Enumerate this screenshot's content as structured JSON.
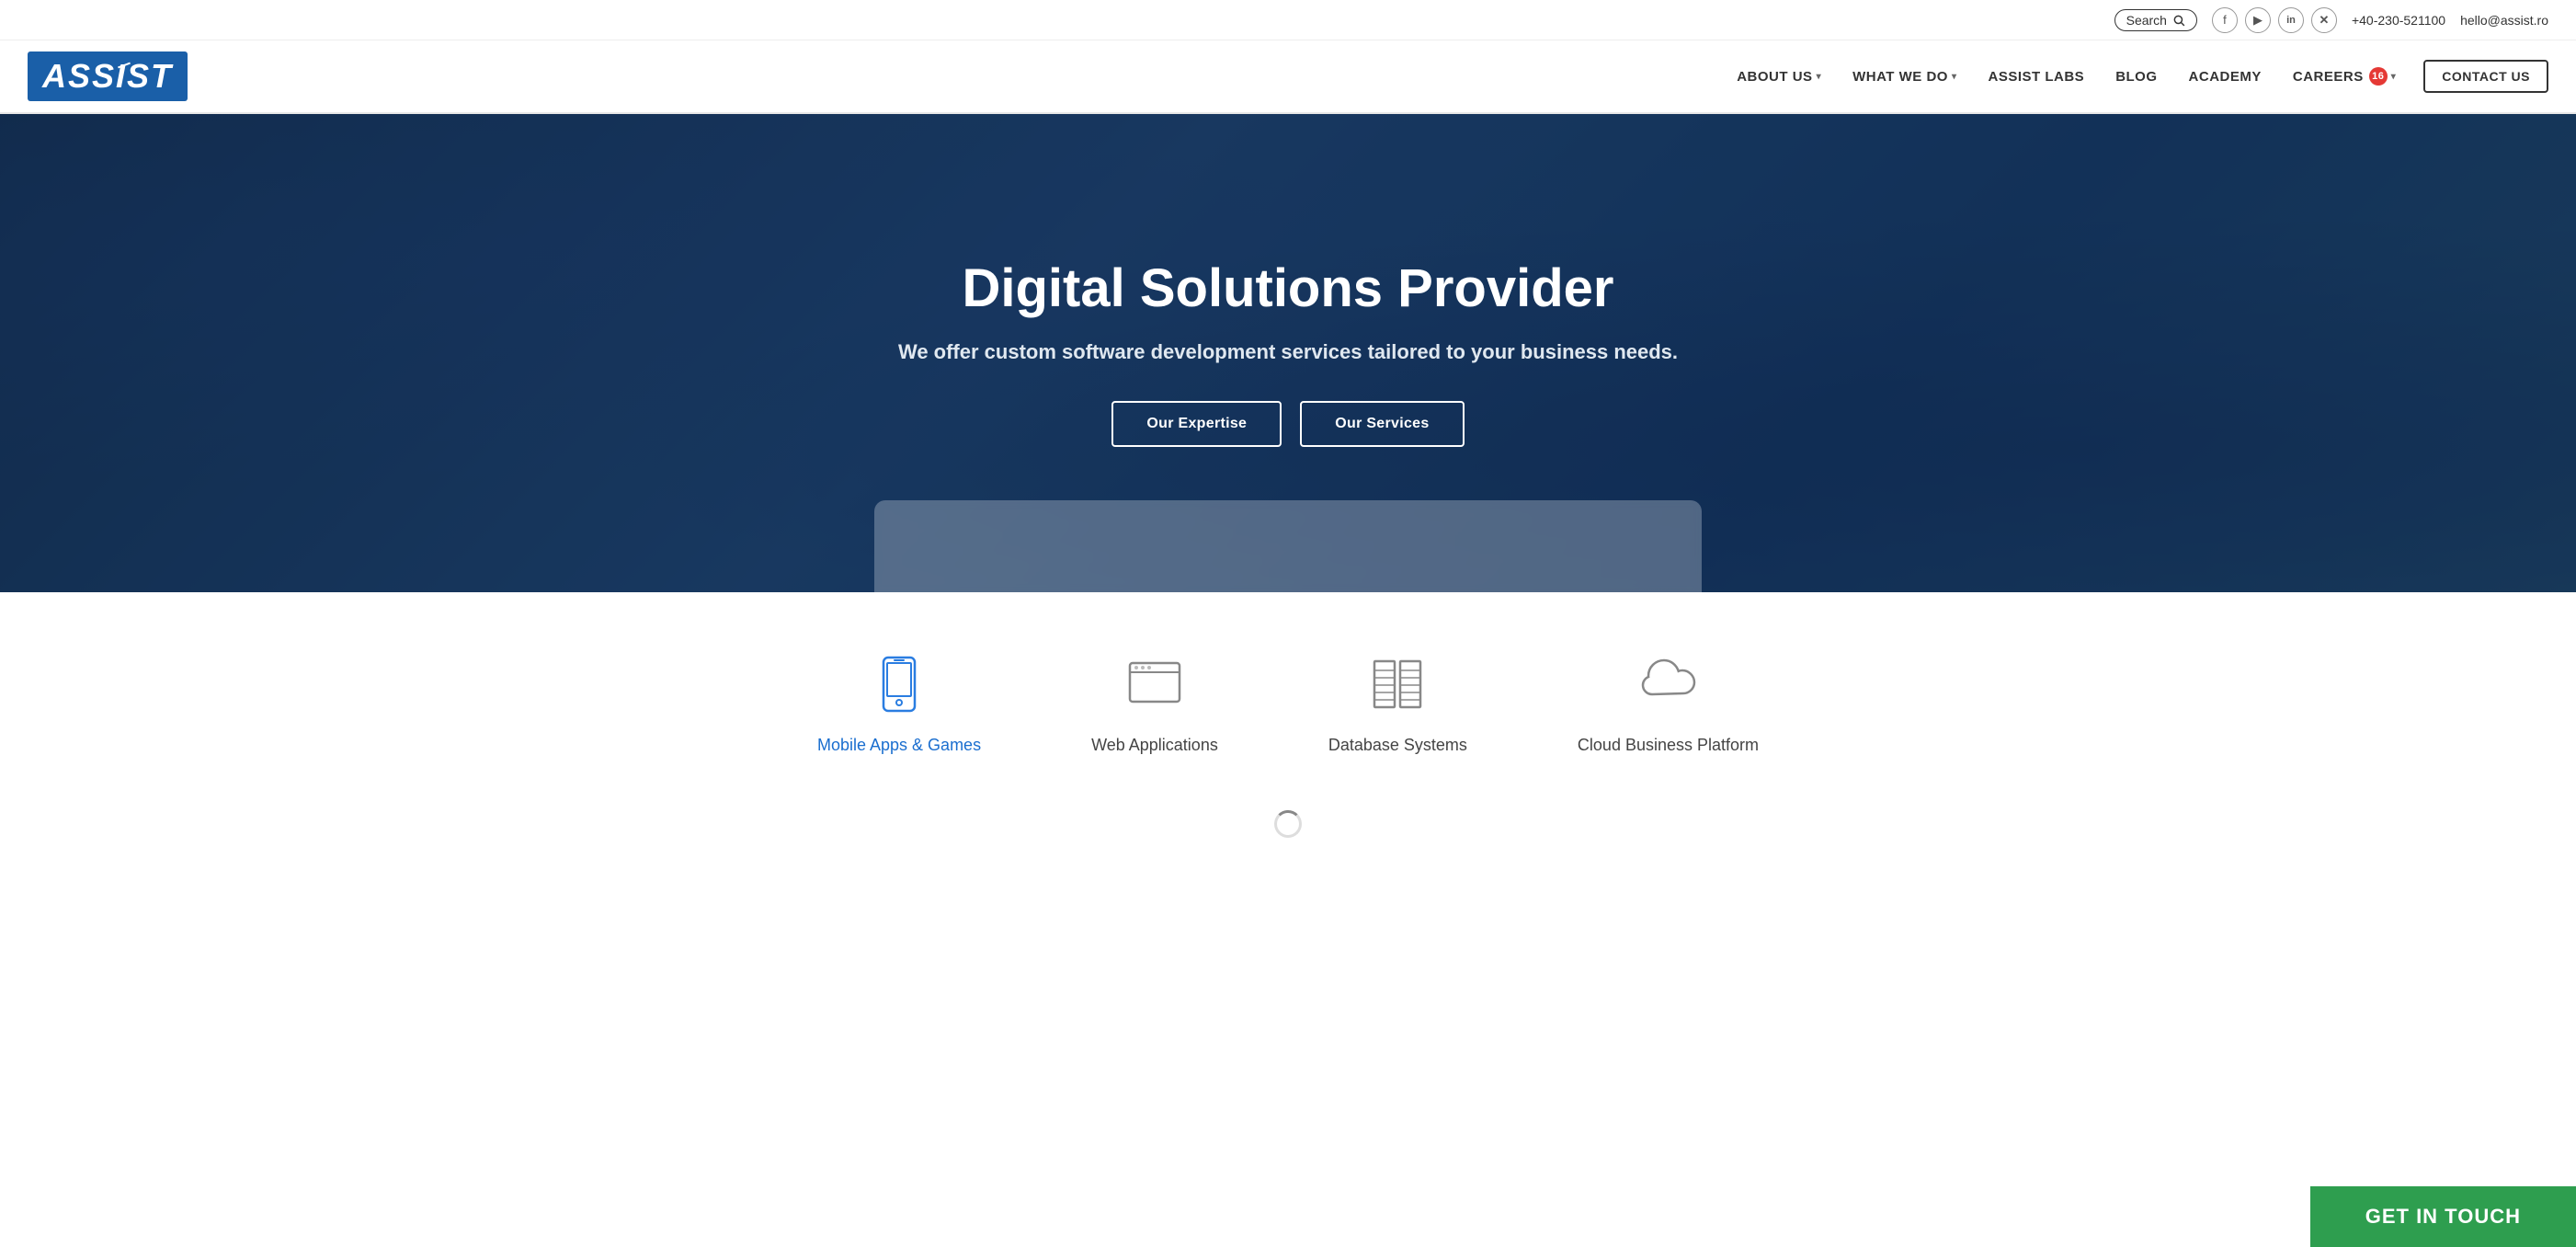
{
  "topbar": {
    "search_label": "Search",
    "search_icon": "search-icon",
    "social": [
      {
        "name": "facebook",
        "symbol": "f"
      },
      {
        "name": "youtube",
        "symbol": "▶"
      },
      {
        "name": "linkedin",
        "symbol": "in"
      },
      {
        "name": "xing",
        "symbol": "X"
      }
    ],
    "phone": "+40-230-521100",
    "email": "hello@assist.ro"
  },
  "nav": {
    "logo": "ASSIST",
    "items": [
      {
        "label": "ABOUT US",
        "has_arrow": true,
        "badge": null
      },
      {
        "label": "WHAT WE DO",
        "has_arrow": true,
        "badge": null
      },
      {
        "label": "ASSIST LABS",
        "has_arrow": false,
        "badge": null
      },
      {
        "label": "BLOG",
        "has_arrow": false,
        "badge": null
      },
      {
        "label": "ACADEMY",
        "has_arrow": false,
        "badge": null
      },
      {
        "label": "CAREERS",
        "has_arrow": true,
        "badge": "16"
      }
    ],
    "contact_btn": "CONTACT US"
  },
  "hero": {
    "title": "Digital Solutions Provider",
    "subtitle": "We offer custom software development services tailored to your business needs.",
    "btn_expertise": "Our Expertise",
    "btn_services": "Our Services"
  },
  "services": [
    {
      "id": "mobile",
      "label": "Mobile Apps & Games",
      "active": true
    },
    {
      "id": "web",
      "label": "Web Applications",
      "active": false
    },
    {
      "id": "database",
      "label": "Database Systems",
      "active": false
    },
    {
      "id": "cloud",
      "label": "Cloud Business Platform",
      "active": false
    }
  ],
  "cta": {
    "label": "GET IN TOUCH"
  }
}
